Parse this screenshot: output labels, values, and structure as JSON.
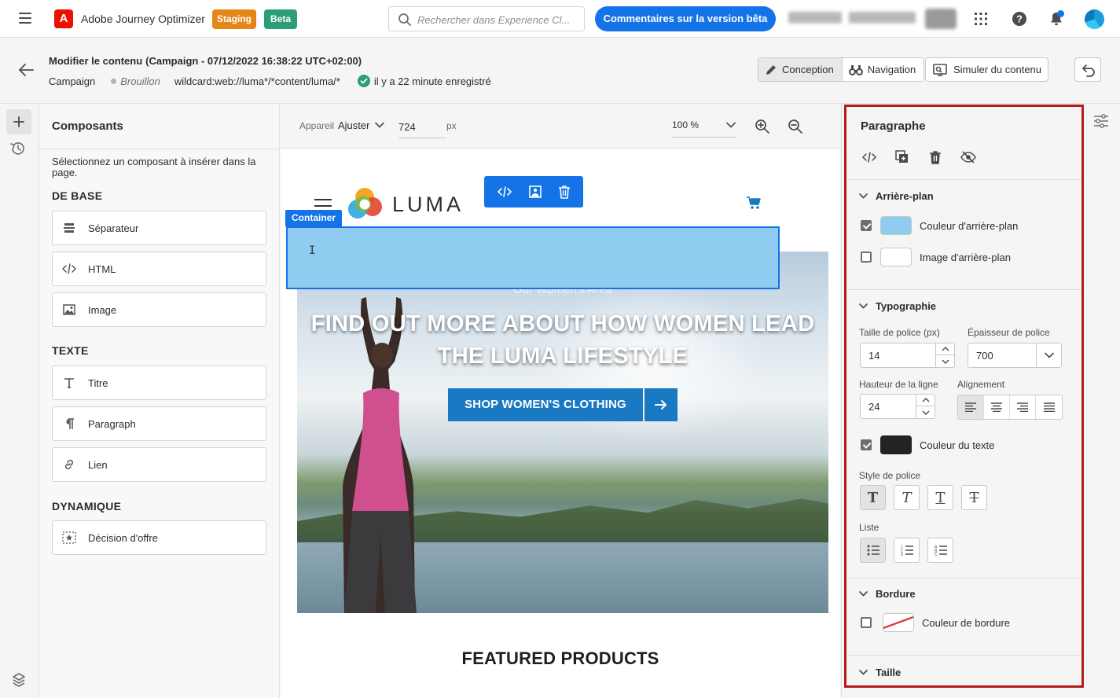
{
  "topbar": {
    "app_name": "Adobe Journey Optimizer",
    "logo_letter": "A",
    "badge_staging": "Staging",
    "badge_beta": "Beta",
    "search_placeholder": "Rechercher dans Experience Cl...",
    "beta_feedback_label": "Commentaires sur la version bêta",
    "colors": {
      "brand": "#eb1000",
      "accent": "#1473e6",
      "staging": "#e68619",
      "beta": "#2d9d78"
    }
  },
  "header": {
    "title": "Modifier le contenu",
    "subtitle": "(Campaign - 07/12/2022 16:38:22 UTC+02:00)",
    "type": "Campaign",
    "status": "Brouillon",
    "url": "wildcard:web://luma*/*content/luma/*",
    "saved_text": "il y a 22 minute enregistré",
    "mode_design": "Conception",
    "mode_navigation": "Navigation",
    "simulate_label": "Simuler du contenu"
  },
  "components": {
    "title": "Composants",
    "description": "Sélectionnez un composant à insérer dans la page.",
    "sections": [
      {
        "title": "DE BASE",
        "items": [
          {
            "label": "Séparateur",
            "icon": "separator-icon"
          },
          {
            "label": "HTML",
            "icon": "code-icon"
          },
          {
            "label": "Image",
            "icon": "image-icon"
          }
        ]
      },
      {
        "title": "TEXTE",
        "items": [
          {
            "label": "Titre",
            "icon": "title-icon"
          },
          {
            "label": "Paragraph",
            "icon": "paragraph-icon"
          },
          {
            "label": "Lien",
            "icon": "link-icon"
          }
        ]
      },
      {
        "title": "DYNAMIQUE",
        "items": [
          {
            "label": "Décision d'offre",
            "icon": "offer-decision-icon"
          }
        ]
      }
    ]
  },
  "canvas_toolbar": {
    "device_label": "Appareil",
    "device_value": "Ajuster",
    "width_value": "724",
    "width_unit": "px",
    "zoom_value": "100 %"
  },
  "canvas": {
    "brand_word": "LUMA",
    "container_tag": "Container",
    "hero_kicker": "Our Women's Area",
    "hero_title": "FIND OUT MORE ABOUT HOW WOMEN LEAD THE LUMA LIFESTYLE",
    "hero_cta": "SHOP WOMEN'S CLOTHING",
    "featured_title": "FEATURED PRODUCTS",
    "selection_color": "#90cbf0"
  },
  "properties": {
    "title": "Paragraphe",
    "background": {
      "section_title": "Arrière-plan",
      "bg_color_label": "Couleur d'arrière-plan",
      "bg_color_checked": true,
      "bg_color_value": "#90cbf0",
      "bg_image_label": "Image d'arrière-plan",
      "bg_image_checked": false
    },
    "typography": {
      "section_title": "Typographie",
      "font_size_label": "Taille de police (px)",
      "font_size_value": "14",
      "font_weight_label": "Épaisseur de police",
      "font_weight_value": "700",
      "line_height_label": "Hauteur de la ligne",
      "line_height_value": "24",
      "alignment_label": "Alignement",
      "alignment_selected": "left",
      "text_color_label": "Couleur du texte",
      "text_color_checked": true,
      "text_color_value": "#222222",
      "font_style_label": "Style de police",
      "font_style_selected": "bold",
      "list_label": "Liste",
      "list_selected": "bullet"
    },
    "border": {
      "section_title": "Bordure",
      "border_color_label": "Couleur de bordure",
      "border_color_checked": false
    },
    "size": {
      "section_title": "Taille"
    }
  }
}
